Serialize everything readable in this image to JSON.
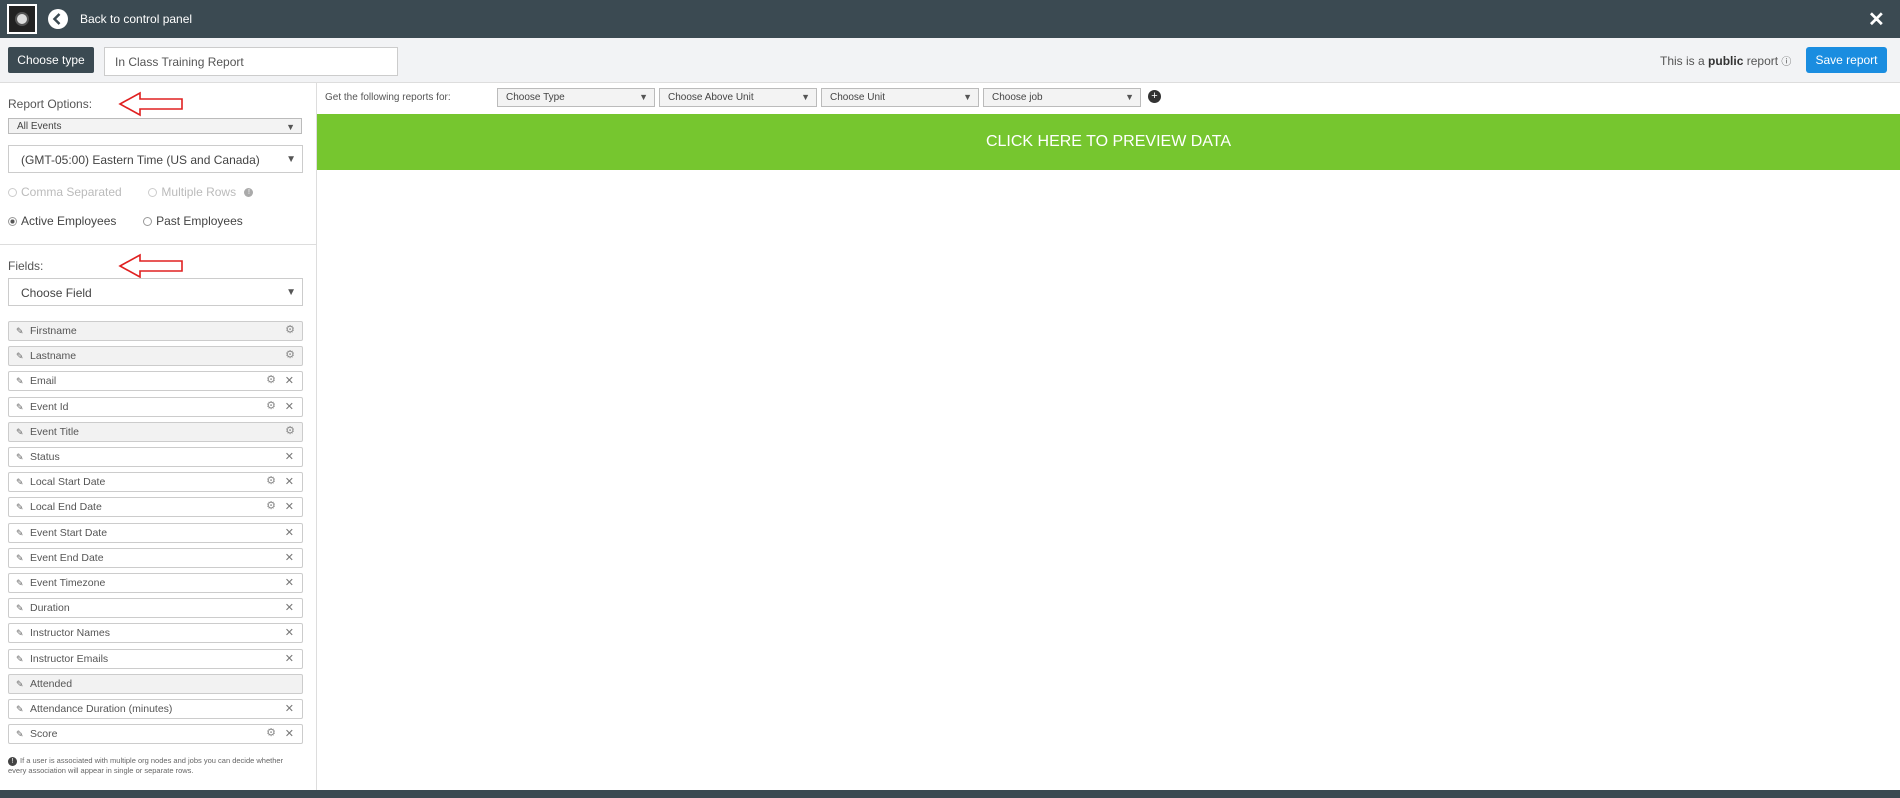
{
  "header": {
    "back_label": "Back to control panel",
    "close_glyph": "✕"
  },
  "toolbar": {
    "choose_type_label": "Choose type",
    "report_title_value": "In Class Training Report",
    "public_prefix": "This is a",
    "public_word": "public",
    "public_suffix": "report",
    "info_glyph": "ⓘ",
    "save_label": "Save report"
  },
  "sidebar": {
    "report_options_label": "Report Options:",
    "events_select": "All Events",
    "timezone_select": "(GMT-05:00) Eastern Time (US and Canada)",
    "format_options": [
      "Comma Separated",
      "Multiple Rows"
    ],
    "employee_options": [
      "Active Employees",
      "Past Employees"
    ],
    "fields_label": "Fields:",
    "choose_field": "Choose Field",
    "fields": [
      {
        "label": "Firstname",
        "gear": true,
        "remove": false,
        "locked": true
      },
      {
        "label": "Lastname",
        "gear": true,
        "remove": false,
        "locked": true
      },
      {
        "label": "Email",
        "gear": true,
        "remove": true,
        "locked": false
      },
      {
        "label": "Event Id",
        "gear": true,
        "remove": true,
        "locked": false
      },
      {
        "label": "Event Title",
        "gear": true,
        "remove": false,
        "locked": true
      },
      {
        "label": "Status",
        "gear": false,
        "remove": true,
        "locked": false
      },
      {
        "label": "Local Start Date",
        "gear": true,
        "remove": true,
        "locked": false
      },
      {
        "label": "Local End Date",
        "gear": true,
        "remove": true,
        "locked": false
      },
      {
        "label": "Event Start Date",
        "gear": false,
        "remove": true,
        "locked": false
      },
      {
        "label": "Event End Date",
        "gear": false,
        "remove": true,
        "locked": false
      },
      {
        "label": "Event Timezone",
        "gear": false,
        "remove": true,
        "locked": false
      },
      {
        "label": "Duration",
        "gear": false,
        "remove": true,
        "locked": false
      },
      {
        "label": "Instructor Names",
        "gear": false,
        "remove": true,
        "locked": false
      },
      {
        "label": "Instructor Emails",
        "gear": false,
        "remove": true,
        "locked": false
      },
      {
        "label": "Attended",
        "gear": false,
        "remove": false,
        "locked": true
      },
      {
        "label": "Attendance Duration (minutes)",
        "gear": false,
        "remove": true,
        "locked": false
      },
      {
        "label": "Score",
        "gear": true,
        "remove": true,
        "locked": false
      }
    ],
    "note": "If a user is associated with multiple org nodes and jobs you can decide whether every association will appear in single or separate rows."
  },
  "filters": {
    "label": "Get the following reports for:",
    "selects": [
      "Choose Type",
      "Choose Above Unit",
      "Choose Unit",
      "Choose job"
    ]
  },
  "preview_label": "CLICK HERE TO PREVIEW DATA",
  "colors": {
    "topbar": "#3b4a52",
    "save_button": "#1a8de0",
    "preview_bar": "#76c62f",
    "annotation_arrow": "#e02020"
  }
}
